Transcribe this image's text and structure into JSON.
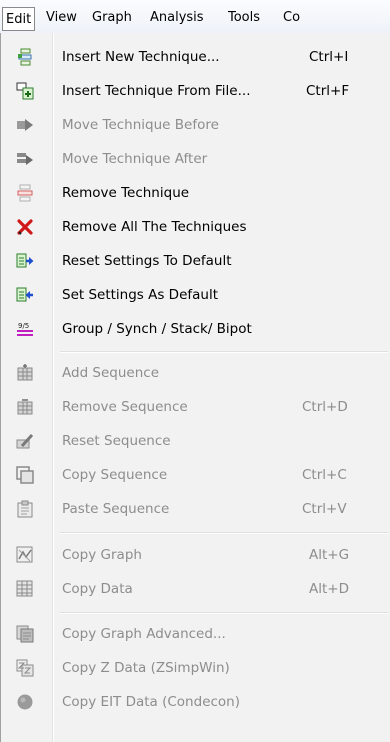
{
  "menubar": {
    "items": [
      "Edit",
      "View",
      "Graph",
      "Analysis",
      "Tools",
      "Co"
    ]
  },
  "edit_menu": {
    "insert_new": {
      "label": "Insert New Technique...",
      "shortcut": "Ctrl+I",
      "icon": "insert-new-technique-icon"
    },
    "insert_from_file": {
      "label": "Insert Technique From File...",
      "shortcut": "Ctrl+F",
      "icon": "insert-technique-file-icon"
    },
    "move_before": {
      "label": "Move Technique Before",
      "icon": "move-before-icon"
    },
    "move_after": {
      "label": "Move Technique After",
      "icon": "move-after-icon"
    },
    "remove": {
      "label": "Remove Technique",
      "icon": "remove-technique-icon"
    },
    "remove_all": {
      "label": "Remove All The Techniques",
      "icon": "red-x-icon"
    },
    "reset_settings": {
      "label": "Reset Settings To Default",
      "icon": "reset-settings-icon"
    },
    "set_settings": {
      "label": "Set Settings As Default",
      "icon": "set-settings-icon"
    },
    "group_synch": {
      "label": "Group / Synch / Stack/ Bipot",
      "icon": "group-synch-icon",
      "icon_text": "9/5"
    },
    "add_sequence": {
      "label": "Add Sequence",
      "icon": "add-sequence-icon"
    },
    "remove_sequence": {
      "label": "Remove Sequence",
      "shortcut": "Ctrl+D",
      "icon": "remove-sequence-icon"
    },
    "reset_sequence": {
      "label": "Reset Sequence",
      "icon": "reset-sequence-icon"
    },
    "copy_sequence": {
      "label": "Copy Sequence",
      "shortcut": "Ctrl+C",
      "icon": "copy-sequence-icon"
    },
    "paste_sequence": {
      "label": "Paste Sequence",
      "shortcut": "Ctrl+V",
      "icon": "paste-sequence-icon"
    },
    "copy_graph": {
      "label": "Copy Graph",
      "shortcut": "Alt+G",
      "icon": "copy-graph-icon"
    },
    "copy_data": {
      "label": "Copy Data",
      "shortcut": "Alt+D",
      "icon": "copy-data-icon"
    },
    "copy_graph_advanced": {
      "label": "Copy Graph Advanced...",
      "icon": "copy-graph-advanced-icon"
    },
    "copy_z_data": {
      "label": "Copy Z Data (ZSimpWin)",
      "icon": "copy-z-data-icon"
    },
    "copy_eit_data": {
      "label": "Copy EIT Data (Condecon)",
      "icon": "copy-eit-data-icon"
    }
  },
  "colors": {
    "menu_bg": "#f2f2f2",
    "disabled_text": "#8d8d8d",
    "remove_all_x": "#d01818",
    "arrow_blue": "#1f4fd0",
    "group_magenta": "#c020c0"
  }
}
